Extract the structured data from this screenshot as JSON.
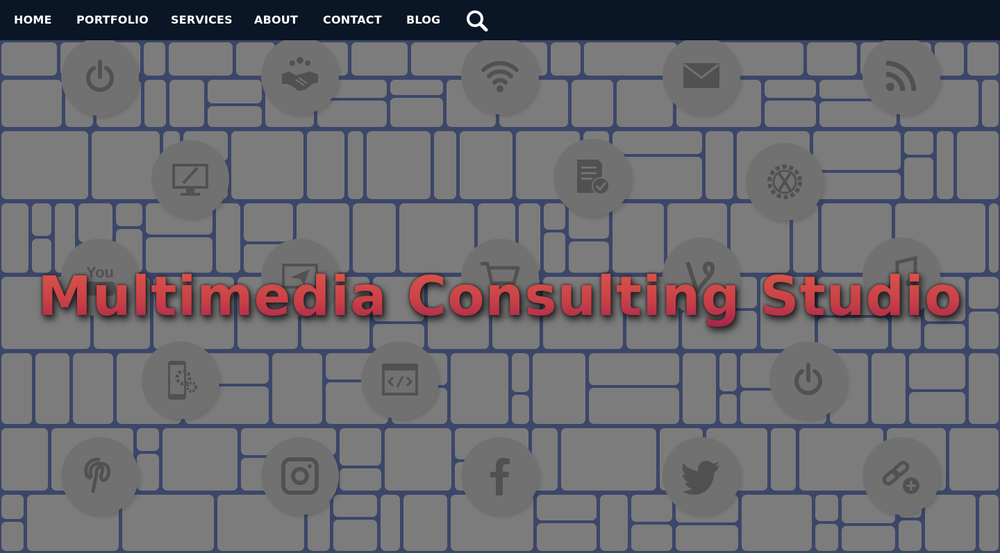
{
  "nav": {
    "items": [
      {
        "label": "HOME"
      },
      {
        "label": "PORTFOLIO"
      },
      {
        "label": "SERVICES"
      },
      {
        "label": "ABOUT"
      },
      {
        "label": "CONTACT"
      },
      {
        "label": "BLOG"
      }
    ],
    "search_icon": "search-icon"
  },
  "hero": {
    "title": "Multimedia Consulting Studio",
    "icons": [
      "power-icon",
      "handshake-money-icon",
      "wifi-icon",
      "envelope-icon",
      "rss-icon",
      "monitor-design-icon",
      "certificate-icon",
      "gear-tools-icon",
      "youtube-icon",
      "send-icon",
      "cart-icon",
      "vine-icon",
      "music-icon",
      "mobile-settings-icon",
      "code-window-icon",
      "power-icon",
      "pinterest-icon",
      "instagram-icon",
      "facebook-icon",
      "twitter-icon",
      "link-add-icon"
    ]
  },
  "colors": {
    "nav_background": "#0a1525",
    "grid_background": "#1c2d63",
    "tile": "#808080",
    "icon_circle": "#6f6f6f",
    "icon_glyph": "#3e3e3e",
    "title_gradient_top": "#e0584a",
    "title_gradient_bottom": "#a3204e"
  }
}
